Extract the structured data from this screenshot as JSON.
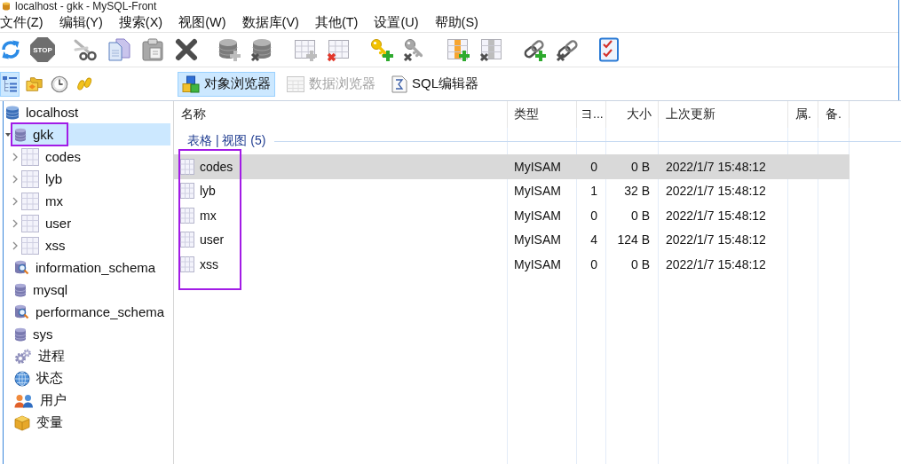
{
  "window": {
    "title": "localhost - gkk - MySQL-Front"
  },
  "menu": [
    "文件(Z)",
    "编辑(Y)",
    "搜索(X)",
    "视图(W)",
    "数据库(V)",
    "其他(T)",
    "设置(U)",
    "帮助(S)"
  ],
  "toolbar": [
    [
      {
        "kind": "refresh"
      },
      {
        "kind": "stop",
        "label": "STOP"
      }
    ],
    [
      {
        "kind": "cut"
      },
      {
        "kind": "copy"
      },
      {
        "kind": "paste"
      },
      {
        "kind": "delete"
      }
    ],
    [
      {
        "kind": "database_add"
      },
      {
        "kind": "database_delete"
      }
    ],
    [
      {
        "kind": "table_add"
      },
      {
        "kind": "table_delete"
      }
    ],
    [
      {
        "kind": "key_add"
      },
      {
        "kind": "key_delete"
      }
    ],
    [
      {
        "kind": "field_add"
      },
      {
        "kind": "field_delete"
      }
    ],
    [
      {
        "kind": "link_add"
      },
      {
        "kind": "link_delete"
      }
    ],
    [
      {
        "kind": "checklist"
      }
    ]
  ],
  "side_tools": [
    {
      "kind": "tree",
      "selected": true
    },
    {
      "kind": "folders",
      "selected": false
    },
    {
      "kind": "clock",
      "selected": false
    },
    {
      "kind": "footprints",
      "selected": false
    }
  ],
  "views": [
    {
      "kind": "object",
      "label": "对象浏览器",
      "selected": true,
      "disabled": false
    },
    {
      "kind": "data",
      "label": "数据浏览器",
      "selected": false,
      "disabled": true
    },
    {
      "kind": "sql",
      "label": "SQL编辑器",
      "selected": false,
      "disabled": false
    }
  ],
  "tree": [
    {
      "kind": "host",
      "label": "localhost",
      "selected": false,
      "marked": false,
      "children": [
        {
          "kind": "database",
          "label": "gkk",
          "expanded": true,
          "selected": true,
          "marked": true,
          "children": [
            {
              "kind": "table",
              "label": "codes",
              "expanded": false,
              "selected": false,
              "marked": false
            },
            {
              "kind": "table",
              "label": "lyb",
              "expanded": false,
              "selected": false,
              "marked": false
            },
            {
              "kind": "table",
              "label": "mx",
              "expanded": false,
              "selected": false,
              "marked": false
            },
            {
              "kind": "table",
              "label": "user",
              "expanded": false,
              "selected": false,
              "marked": false
            },
            {
              "kind": "table",
              "label": "xss",
              "expanded": false,
              "selected": false,
              "marked": false
            }
          ]
        },
        {
          "kind": "system_database",
          "label": "information_schema",
          "selected": false,
          "marked": false
        },
        {
          "kind": "database",
          "label": "mysql",
          "selected": false,
          "marked": false
        },
        {
          "kind": "system_database",
          "label": "performance_schema",
          "selected": false,
          "marked": false
        },
        {
          "kind": "database",
          "label": "sys",
          "selected": false,
          "marked": false
        },
        {
          "kind": "processes",
          "label": "进程",
          "selected": false,
          "marked": false
        },
        {
          "kind": "status",
          "label": "状态",
          "selected": false,
          "marked": false
        },
        {
          "kind": "users",
          "label": "用户",
          "selected": false,
          "marked": false
        },
        {
          "kind": "variables",
          "label": "变量",
          "selected": false,
          "marked": false
        }
      ]
    }
  ],
  "object_list": {
    "columns": [
      "名称",
      "类型",
      "ヨ...",
      "大小",
      "上次更新",
      "属.",
      "备."
    ],
    "group": "表格 | 视图 (5)",
    "names_marked": true,
    "rows": [
      {
        "kind": "table",
        "selected": true,
        "cells": [
          "codes",
          "MyISAM",
          "0",
          "0 B",
          "2022/1/7 15:48:12"
        ]
      },
      {
        "kind": "table",
        "selected": false,
        "cells": [
          "lyb",
          "MyISAM",
          "1",
          "32 B",
          "2022/1/7 15:48:12"
        ]
      },
      {
        "kind": "table",
        "selected": false,
        "cells": [
          "mx",
          "MyISAM",
          "0",
          "0 B",
          "2022/1/7 15:48:12"
        ]
      },
      {
        "kind": "table",
        "selected": false,
        "cells": [
          "user",
          "MyISAM",
          "4",
          "124 B",
          "2022/1/7 15:48:12"
        ]
      },
      {
        "kind": "table",
        "selected": false,
        "cells": [
          "xss",
          "MyISAM",
          "0",
          "0 B",
          "2022/1/7 15:48:12"
        ]
      }
    ]
  }
}
